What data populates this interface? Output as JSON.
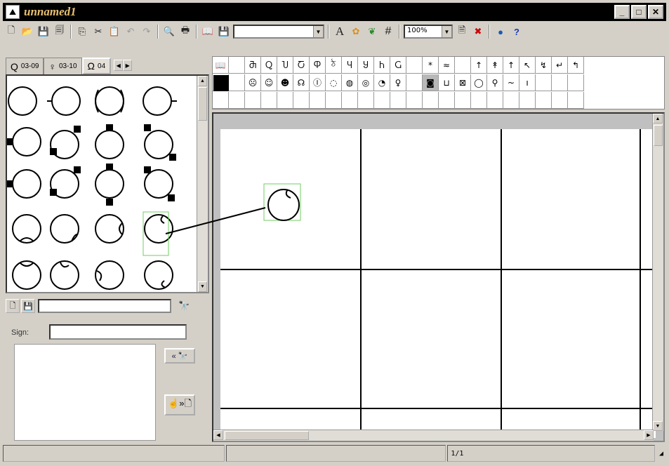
{
  "window": {
    "title": "unnamed1",
    "app_icon": "mountain-app-icon",
    "min_label": "_",
    "max_label": "□",
    "close_label": "✕"
  },
  "toolbar": {
    "icons": [
      "new-file-icon",
      "open-folder-icon",
      "save-icon",
      "save-all-icon",
      "copy-icon",
      "cut-icon",
      "paste-icon",
      "undo-icon",
      "redo-icon",
      "print-preview-icon",
      "print-icon",
      "book-icon",
      "save-disk-icon"
    ],
    "font_combo_value": "",
    "font_icon": "A",
    "grid_icon": "#",
    "zoom_value": "100%",
    "right_icons": [
      "document-icon",
      "delete-icon",
      "globe-icon",
      "help-icon"
    ],
    "help_label": "?"
  },
  "tabs": [
    {
      "label": "03-09",
      "glyph": "Q"
    },
    {
      "label": "03-10",
      "glyph": "♀"
    },
    {
      "label": "04",
      "glyph": "Ω"
    }
  ],
  "lower_panel": {
    "sign_label": "Sign:",
    "search_value": "",
    "sign_value": "",
    "insert_button": "« 🔭",
    "apply_button": "☝»🗋"
  },
  "palette": {
    "row1": [
      "📖",
      "",
      "Ⴋ",
      "Ⴍ",
      "Ⴎ",
      "Ⴀ",
      "Ⴔ",
      "ঠ",
      "Ⴗ",
      "Ⴘ",
      "Ⴙ",
      "Ⴚ",
      "",
      "*",
      "≈",
      "",
      "↑",
      "↟",
      "↑",
      "↖",
      "↯",
      "↵",
      "↰"
    ],
    "row2": [
      "",
      "",
      "☹",
      "☺",
      "☻",
      "☊",
      "Ⓘ",
      "◌",
      "◍",
      "◎",
      "◔",
      "♀",
      "",
      "◙",
      "⊔",
      "⊠",
      "◯",
      "⚲",
      "~",
      "ı",
      "",
      "",
      ""
    ],
    "row3": [
      "",
      "",
      "",
      "",
      "",
      "",
      "",
      "",
      "",
      "",
      "",
      "",
      "",
      "",
      "",
      "",
      "",
      "",
      "",
      "",
      "",
      "",
      ""
    ]
  },
  "status": {
    "pane1": "",
    "pane2": "",
    "pane3": "1/1",
    "pane4": ""
  }
}
